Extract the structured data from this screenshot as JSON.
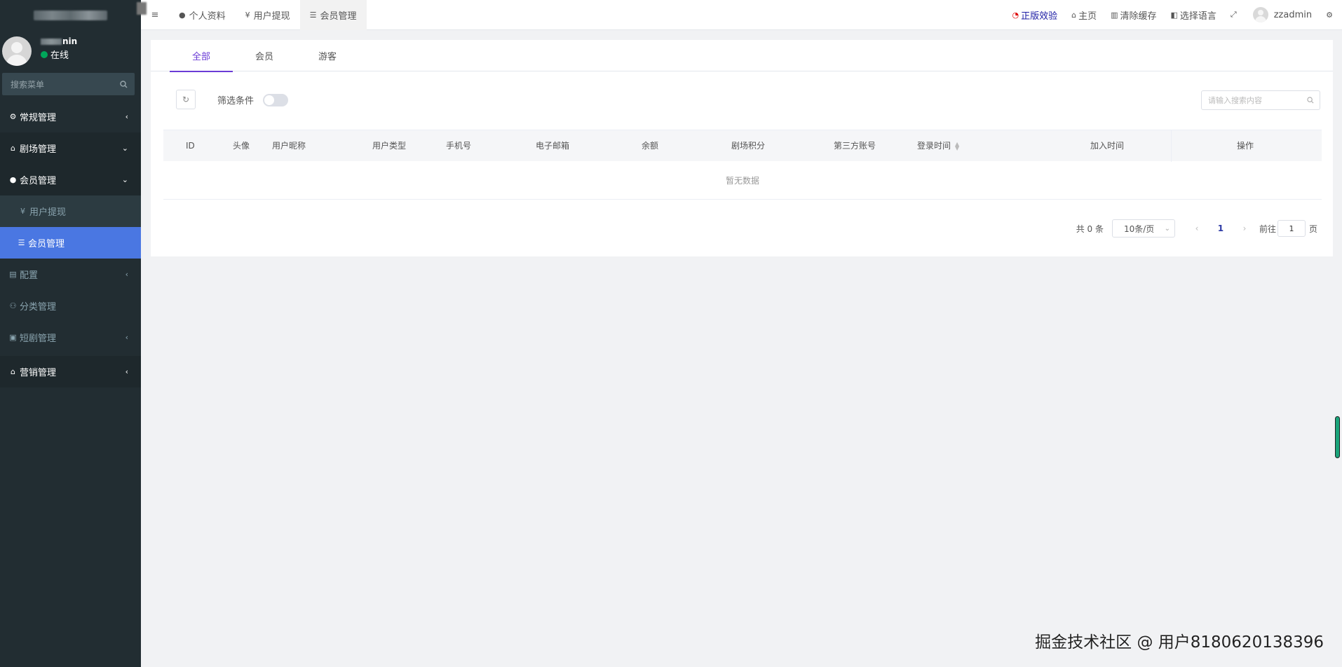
{
  "sidebar": {
    "user_name_suffix": "nin",
    "user_status": "在线",
    "search_placeholder": "搜索菜单",
    "menu": {
      "regular": "常规管理",
      "theater": "剧场管理",
      "member_group": "会员管理",
      "withdraw": "用户提现",
      "member_active": "会员管理",
      "config": "配置",
      "category": "分类管理",
      "short_drama": "短剧管理",
      "marketing": "营销管理"
    }
  },
  "navbar": {
    "tabs": [
      {
        "label": "个人资料",
        "icon": "user-icon"
      },
      {
        "label": "用户提现",
        "icon": "yen-icon"
      },
      {
        "label": "会员管理",
        "icon": "list-icon"
      }
    ],
    "right": {
      "genuine": "正版效验",
      "home": "主页",
      "clear_cache": "清除缓存",
      "language": "选择语言",
      "username": "zzadmin"
    }
  },
  "content": {
    "tabs": [
      "全部",
      "会员",
      "游客"
    ],
    "filter_label": "筛选条件",
    "search_placeholder": "请输入搜索内容",
    "columns": [
      "ID",
      "头像",
      "用户昵称",
      "用户类型",
      "手机号",
      "电子邮箱",
      "余额",
      "剧场积分",
      "第三方账号",
      "登录时间",
      "加入时间",
      "操作"
    ],
    "empty_text": "暂无数据",
    "pagination": {
      "total": "共 0 条",
      "page_size": "10条/页",
      "current_page": "1",
      "goto_label": "前往",
      "goto_value": "1",
      "page_suffix": "页"
    }
  },
  "watermark": "掘金技术社区 @ 用户8180620138396",
  "colors": {
    "sidebar_bg": "#222d32",
    "active_menu": "#4a77e2",
    "tab_accent": "#6a3bd6",
    "status_online": "#00a65a"
  }
}
